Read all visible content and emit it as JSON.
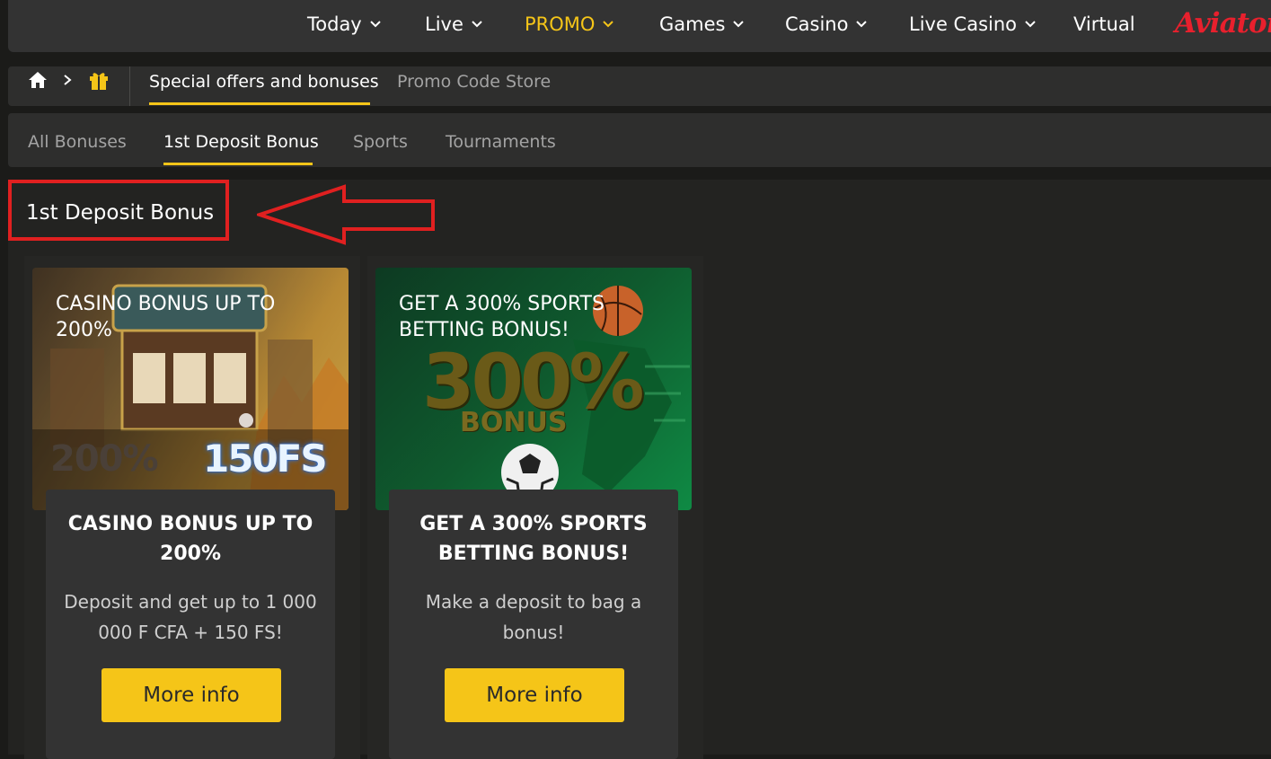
{
  "nav": {
    "items": [
      {
        "label": "Today",
        "has_dropdown": true
      },
      {
        "label": "Live",
        "has_dropdown": true
      },
      {
        "label": "PROMO",
        "has_dropdown": true,
        "active": true
      },
      {
        "label": "Games",
        "has_dropdown": true
      },
      {
        "label": "Casino",
        "has_dropdown": true
      },
      {
        "label": "Live Casino",
        "has_dropdown": true
      },
      {
        "label": "Virtual",
        "has_dropdown": false
      }
    ],
    "brand": "Aviator"
  },
  "breadcrumb": {
    "icons": [
      "home-icon",
      "chevron-right-icon",
      "gift-icon"
    ],
    "tabs": [
      {
        "label": "Special offers and bonuses",
        "active": true
      },
      {
        "label": "Promo Code Store",
        "active": false
      }
    ]
  },
  "categories": [
    {
      "label": "All Bonuses",
      "active": false
    },
    {
      "label": "1st Deposit Bonus",
      "active": true
    },
    {
      "label": "Sports",
      "active": false
    },
    {
      "label": "Tournaments",
      "active": false
    }
  ],
  "section_title": "1st Deposit Bonus",
  "cards": [
    {
      "image_title": "CASINO BONUS UP TO 200%",
      "image_badge_left": "200%",
      "image_badge_right": "150FS",
      "title": "CASINO BONUS UP TO 200%",
      "description": "Deposit and get up to 1 000 000 F CFA + 150 FS!",
      "button": "More info"
    },
    {
      "image_title": "GET A 300% SPORTS BETTING BONUS!",
      "image_big": "300%",
      "image_sub": "BONUS",
      "title": "GET A 300% SPORTS BETTING BONUS!",
      "description": "Make a deposit to bag a bonus!",
      "button": "More info"
    }
  ],
  "colors": {
    "accent": "#f5c518",
    "annotation": "#e02020",
    "brand": "#e8202d"
  }
}
